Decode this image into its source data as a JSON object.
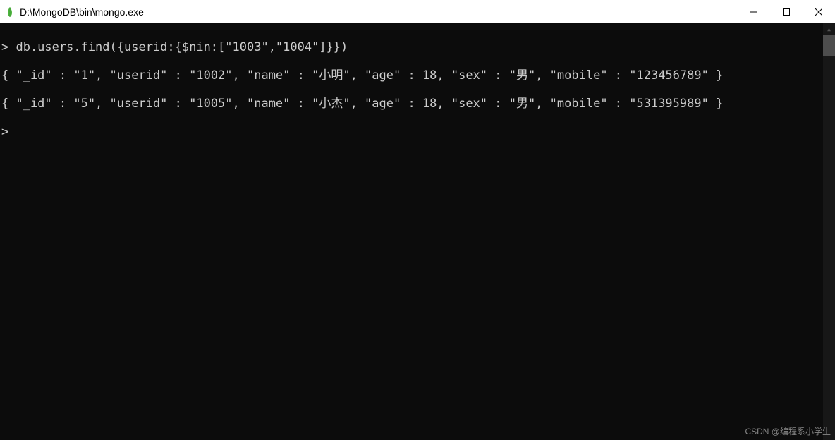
{
  "window": {
    "title": "D:\\MongoDB\\bin\\mongo.exe"
  },
  "terminal": {
    "lines": [
      "> db.users.find({userid:{$nin:[\"1003\",\"1004\"]}})",
      "{ \"_id\" : \"1\", \"userid\" : \"1002\", \"name\" : \"小明\", \"age\" : 18, \"sex\" : \"男\", \"mobile\" : \"123456789\" }",
      "{ \"_id\" : \"5\", \"userid\" : \"1005\", \"name\" : \"小杰\", \"age\" : 18, \"sex\" : \"男\", \"mobile\" : \"531395989\" }",
      ">"
    ]
  },
  "watermark": "CSDN @编程系小学生"
}
